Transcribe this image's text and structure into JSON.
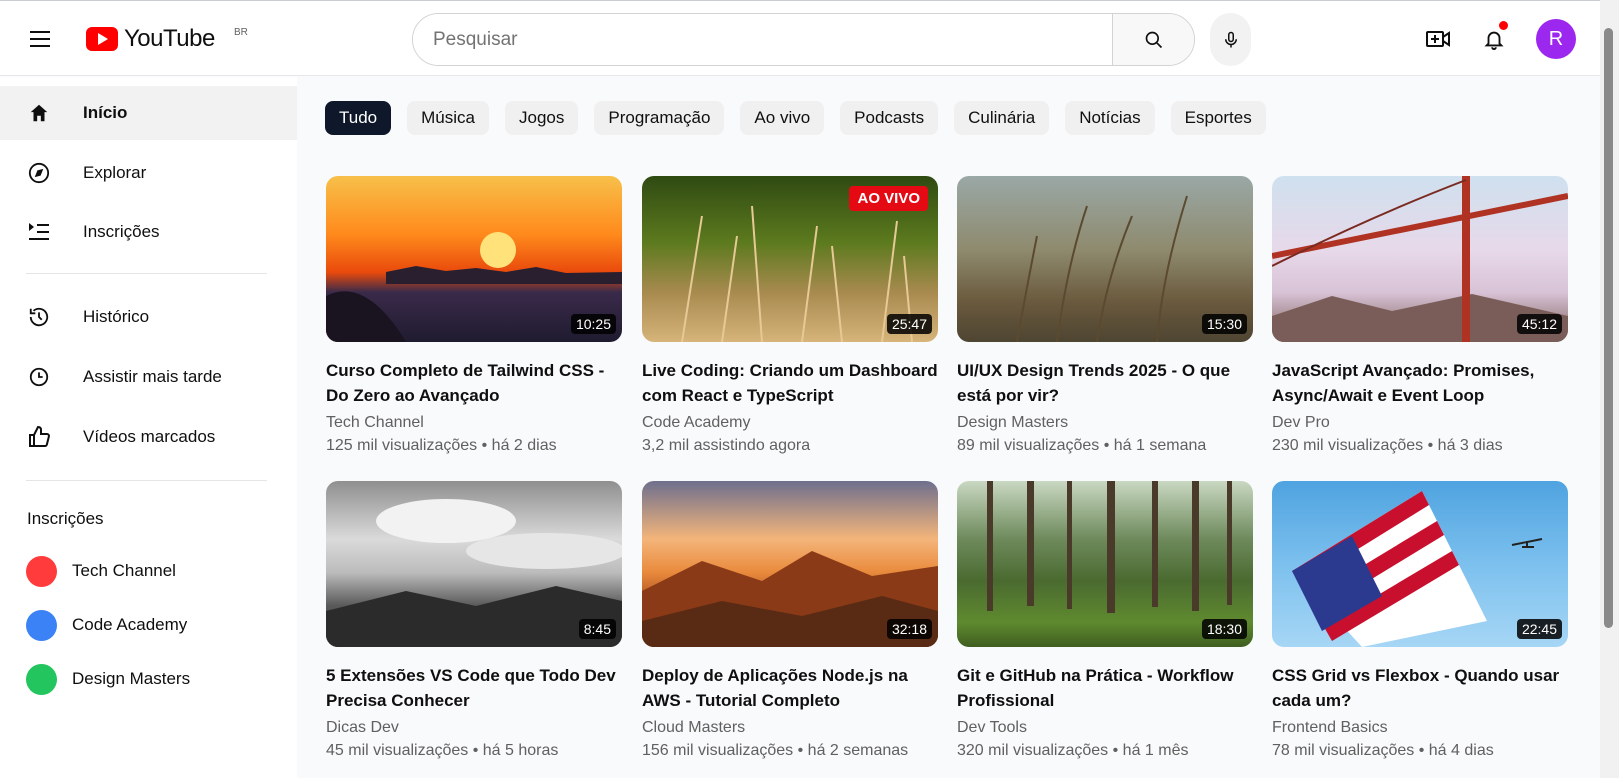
{
  "header": {
    "logo_text": "YouTube",
    "country_code": "BR",
    "search_placeholder": "Pesquisar",
    "avatar_letter": "R",
    "colors": {
      "brand": "#ff0000",
      "avatar": "#9c27ee"
    }
  },
  "sidebar": {
    "main": [
      {
        "label": "Início",
        "icon": "home-icon",
        "active": true
      },
      {
        "label": "Explorar",
        "icon": "compass-icon"
      },
      {
        "label": "Inscrições",
        "icon": "subscriptions-icon"
      }
    ],
    "library": [
      {
        "label": "Histórico",
        "icon": "history-icon"
      },
      {
        "label": "Assistir mais tarde",
        "icon": "clock-icon"
      },
      {
        "label": "Vídeos marcados",
        "icon": "thumbs-up-icon"
      }
    ],
    "subscriptions_heading": "Inscrições",
    "subscriptions": [
      {
        "name": "Tech Channel",
        "color": "#ff3b3b"
      },
      {
        "name": "Code Academy",
        "color": "#3b82f6"
      },
      {
        "name": "Design Masters",
        "color": "#22c55e"
      }
    ]
  },
  "chips": [
    "Tudo",
    "Música",
    "Jogos",
    "Programação",
    "Ao vivo",
    "Podcasts",
    "Culinária",
    "Notícias",
    "Esportes"
  ],
  "videos": [
    {
      "title": "Curso Completo de Tailwind CSS - Do Zero ao Avançado",
      "channel": "Tech Channel",
      "meta": "125 mil visualizações • há 2 dias",
      "duration": "10:25",
      "thumb": "sunset"
    },
    {
      "title": "Live Coding: Criando um Dashboard com React e TypeScript",
      "channel": "Code Academy",
      "meta": "3,2 mil assistindo agora",
      "duration": "25:47",
      "live": "AO VIVO",
      "thumb": "grass"
    },
    {
      "title": "UI/UX Design Trends 2025 - O que está por vir?",
      "channel": "Design Masters",
      "meta": "89 mil visualizações • há 1 semana",
      "duration": "15:30",
      "thumb": "wheat"
    },
    {
      "title": "JavaScript Avançado: Promises, Async/Await e Event Loop",
      "channel": "Dev Pro",
      "meta": "230 mil visualizações • há 3 dias",
      "duration": "45:12",
      "thumb": "bridge"
    },
    {
      "title": "5 Extensões VS Code que Todo Dev Precisa Conhecer",
      "channel": "Dicas Dev",
      "meta": "45 mil visualizações • há 5 horas",
      "duration": "8:45",
      "thumb": "clouds"
    },
    {
      "title": "Deploy de Aplicações Node.js na AWS - Tutorial Completo",
      "channel": "Cloud Masters",
      "meta": "156 mil visualizações • há 2 semanas",
      "duration": "32:18",
      "thumb": "mountain"
    },
    {
      "title": "Git e GitHub na Prática - Workflow Profissional",
      "channel": "Dev Tools",
      "meta": "320 mil visualizações • há 1 mês",
      "duration": "18:30",
      "thumb": "forest"
    },
    {
      "title": "CSS Grid vs Flexbox - Quando usar cada um?",
      "channel": "Frontend Basics",
      "meta": "78 mil visualizações • há 4 dias",
      "duration": "22:45",
      "thumb": "flag"
    }
  ]
}
